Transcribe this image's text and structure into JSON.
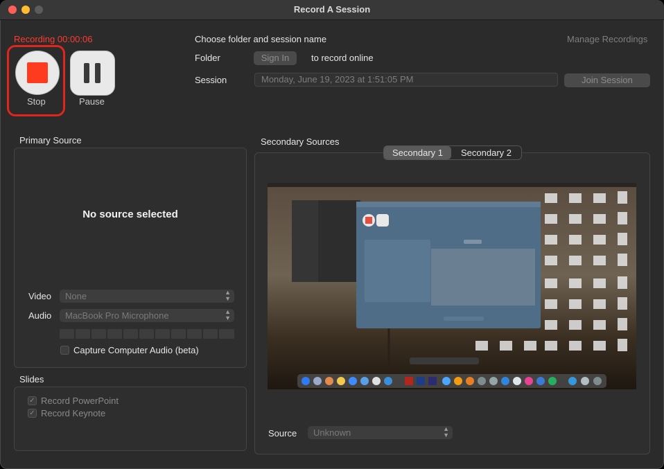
{
  "window": {
    "title": "Record A Session"
  },
  "recording": {
    "status": "Recording 00:00:06",
    "stop_label": "Stop",
    "pause_label": "Pause"
  },
  "header": {
    "choose_label": "Choose folder and session name",
    "manage_label": "Manage Recordings",
    "folder_label": "Folder",
    "sign_in_label": "Sign In",
    "record_online_label": "to record online",
    "session_label": "Session",
    "session_value": "Monday, June 19, 2023 at 1:51:05 PM",
    "join_label": "Join Session"
  },
  "primary": {
    "title": "Primary Source",
    "no_source": "No source selected",
    "video_label": "Video",
    "video_value": "None",
    "audio_label": "Audio",
    "audio_value": "MacBook Pro Microphone",
    "capture_audio_label": "Capture Computer Audio (beta)"
  },
  "slides": {
    "title": "Slides",
    "record_powerpoint": "Record PowerPoint",
    "record_keynote": "Record Keynote"
  },
  "secondary": {
    "title": "Secondary Sources",
    "tabs": [
      "Secondary 1",
      "Secondary 2"
    ],
    "selected_tab": "Secondary 1",
    "source_label": "Source",
    "source_value": "Unknown"
  },
  "colors": {
    "recording_red": "#ff3b30",
    "highlight_red": "#e0261c",
    "window_bg": "#2b2b2b"
  }
}
